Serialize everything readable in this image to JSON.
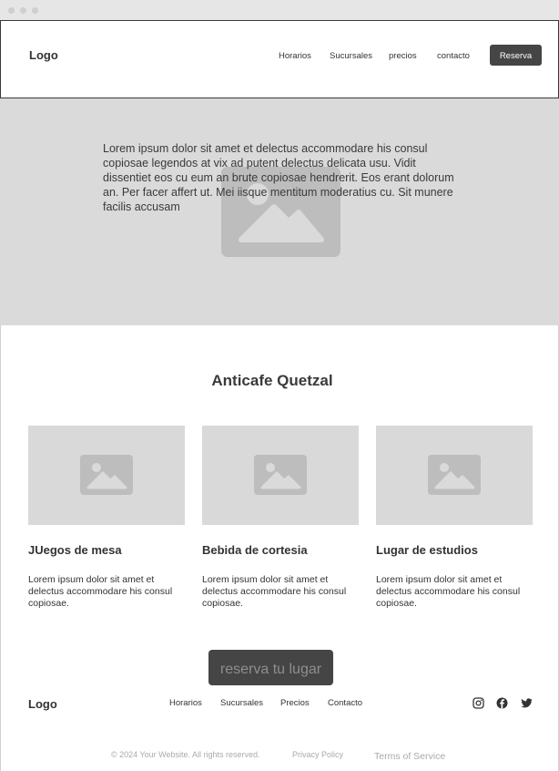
{
  "header": {
    "logo": "Logo",
    "nav": [
      "Horarios",
      "Sucursales",
      "precios",
      "contacto"
    ],
    "cta_label": "Reserva"
  },
  "hero": {
    "text": "Lorem ipsum dolor sit amet et delectus accommodare his consul copiosae legendos at vix ad putent delectus delicata usu. Vidit dissentiet eos cu eum an brute copiosae hendrerit. Eos erant dolorum an. Per facer affert ut. Mei iisque mentitum moderatius cu. Sit munere facilis accusam"
  },
  "features": {
    "title": "Anticafe Quetzal",
    "cards": [
      {
        "title": "JUegos de mesa",
        "desc": "Lorem ipsum dolor sit amet et delectus accommodare his consul copiosae."
      },
      {
        "title": "Bebida de cortesia",
        "desc": "Lorem ipsum dolor sit amet et delectus accommodare his consul copiosae."
      },
      {
        "title": "Lugar de estudios",
        "desc": "Lorem ipsum dolor sit amet et delectus accommodare his consul copiosae."
      }
    ],
    "cta_label": "reserva tu lugar"
  },
  "footer": {
    "logo": "Logo",
    "nav": [
      "Horarios",
      "Sucursales",
      "Precios",
      "Contacto"
    ],
    "social_icons": [
      "instagram-icon",
      "facebook-icon",
      "twitter-icon"
    ],
    "copyright": "© 2024 Your Website. All rights reserved.",
    "privacy": "Privacy Policy",
    "terms": "Terms of Service"
  },
  "colors": {
    "placeholder_bg": "#dadada",
    "placeholder_icon": "#bdbdbd",
    "button_bg": "#454545",
    "muted_text": "#aaaaaa"
  }
}
